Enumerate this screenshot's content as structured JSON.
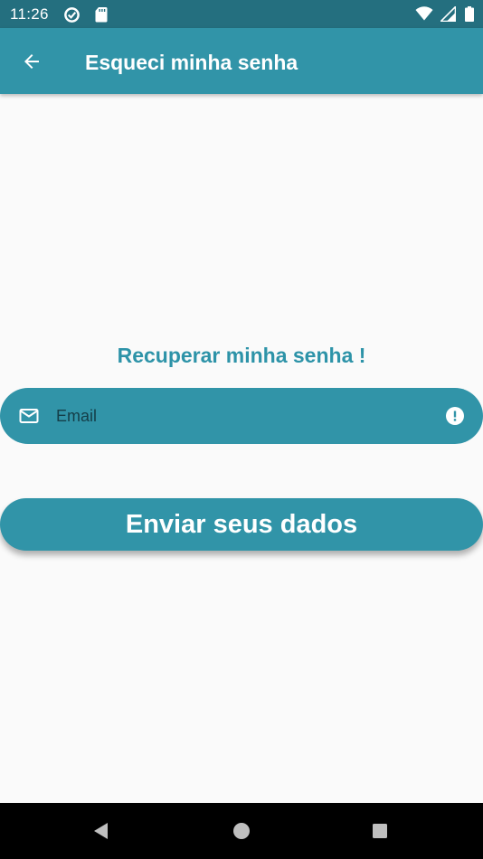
{
  "status_bar": {
    "time": "11:26",
    "icons_left": [
      "data-saver-icon",
      "sd-card-icon"
    ],
    "icons_right": [
      "wifi-icon",
      "signal-icon",
      "battery-icon"
    ]
  },
  "app_bar": {
    "back_icon": "arrow-left-icon",
    "title": "Esqueci minha senha"
  },
  "content": {
    "heading": "Recuperar minha senha !",
    "email_field": {
      "icon": "mail-icon",
      "value": "",
      "placeholder": "Email",
      "trailing_icon": "error-icon"
    },
    "submit_label": "Enviar seus dados"
  },
  "nav_bar": {
    "buttons": [
      "back-triangle-icon",
      "home-circle-icon",
      "recents-square-icon"
    ]
  },
  "colors": {
    "status_bar": "#246f7f",
    "primary": "#3194a8",
    "heading": "#2d93a8",
    "background": "#fafafa",
    "nav_bar": "#000000"
  }
}
